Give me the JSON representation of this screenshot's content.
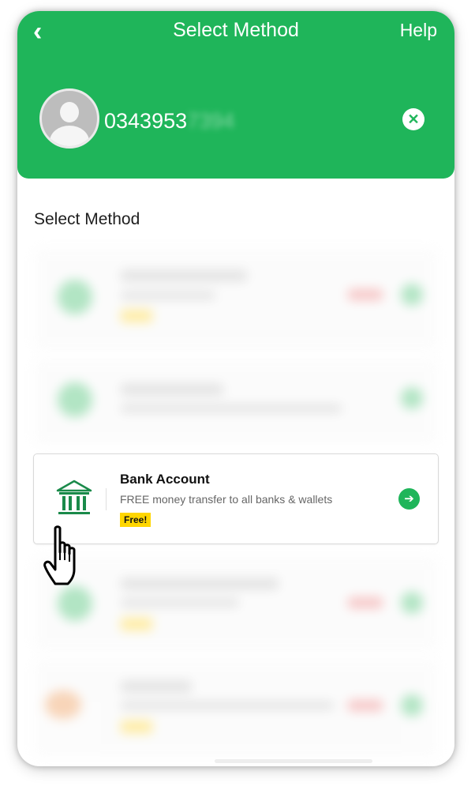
{
  "header": {
    "back_label": "‹",
    "title": "Select Method",
    "help_label": "Help",
    "phone_visible": "0343953",
    "phone_masked": "7394",
    "clear_label": "✕"
  },
  "section_title": "Select Method",
  "methods": [
    {
      "name": "Bank Account",
      "description": "FREE money transfer to all banks & wallets",
      "badge": "Free!",
      "arrow": "➔",
      "icon": "bank-icon"
    }
  ],
  "colors": {
    "brand_green": "#1fb55a",
    "badge_yellow": "#ffd600"
  }
}
